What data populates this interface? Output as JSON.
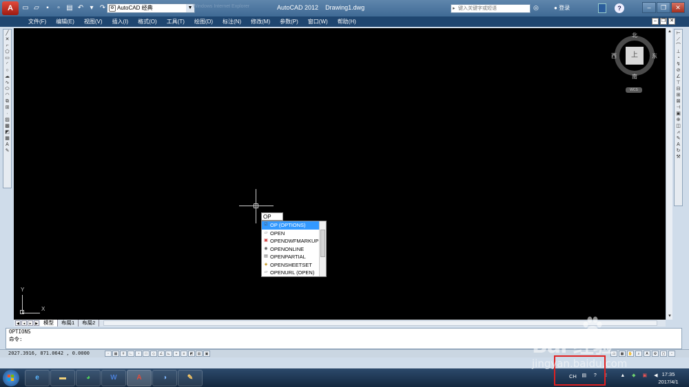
{
  "titlebar": {
    "app_title": "AutoCAD 2012",
    "document": "Drawing1.dwg",
    "ghost_title": "Windows Internet Explorer",
    "workspace": "AutoCAD 经典",
    "search_placeholder": "键入关键字或短语",
    "login": "登录",
    "help": "?",
    "minimize": "–",
    "restore": "❐",
    "close": "✕"
  },
  "menu": [
    "文件(F)",
    "编辑(E)",
    "视图(V)",
    "插入(I)",
    "格式(O)",
    "工具(T)",
    "绘图(D)",
    "标注(N)",
    "修改(M)",
    "参数(P)",
    "窗口(W)",
    "帮助(H)"
  ],
  "command_input": "OP",
  "autocomplete": [
    "OP (OPTIONS)",
    "OPEN",
    "OPENDWFMARKUP",
    "OPENONLINE",
    "OPENPARTIAL",
    "OPENSHEETSET",
    "OPENURL (OPEN)"
  ],
  "viewcube": {
    "north": "北",
    "south": "南",
    "east": "东",
    "west": "西",
    "top": "上",
    "wcs": "WCS"
  },
  "ucs": {
    "x": "X",
    "y": "Y"
  },
  "tabs": [
    "模型",
    "布局1",
    "布局2"
  ],
  "command_window": {
    "history": "OPTIONS",
    "prompt": "命令:"
  },
  "status": {
    "coords": "2027.3916, 871.0642 , 0.0000"
  },
  "taskbar": {
    "tray_lang": "CH",
    "time": "17:35",
    "date": "2017/4/1"
  },
  "watermark": {
    "brand": "Bai  经验",
    "url": "jingyan.baidu.com"
  }
}
